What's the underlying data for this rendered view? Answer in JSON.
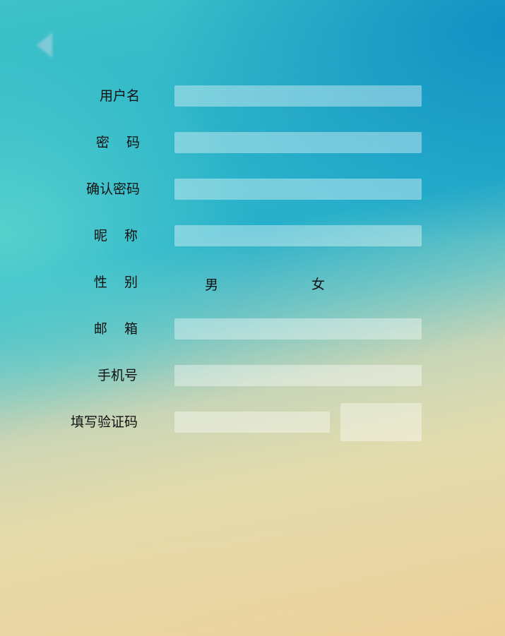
{
  "form": {
    "username_label": "用户名",
    "password_label": "密    码",
    "confirm_password_label": "确认密码",
    "nickname_label": "昵    称",
    "gender_label": "性    别",
    "gender_options": [
      "男",
      "女"
    ],
    "email_label": "邮    箱",
    "phone_label": "手机号",
    "captcha_label": "填写验证码"
  },
  "icons": {
    "back": "back-arrow-icon"
  }
}
